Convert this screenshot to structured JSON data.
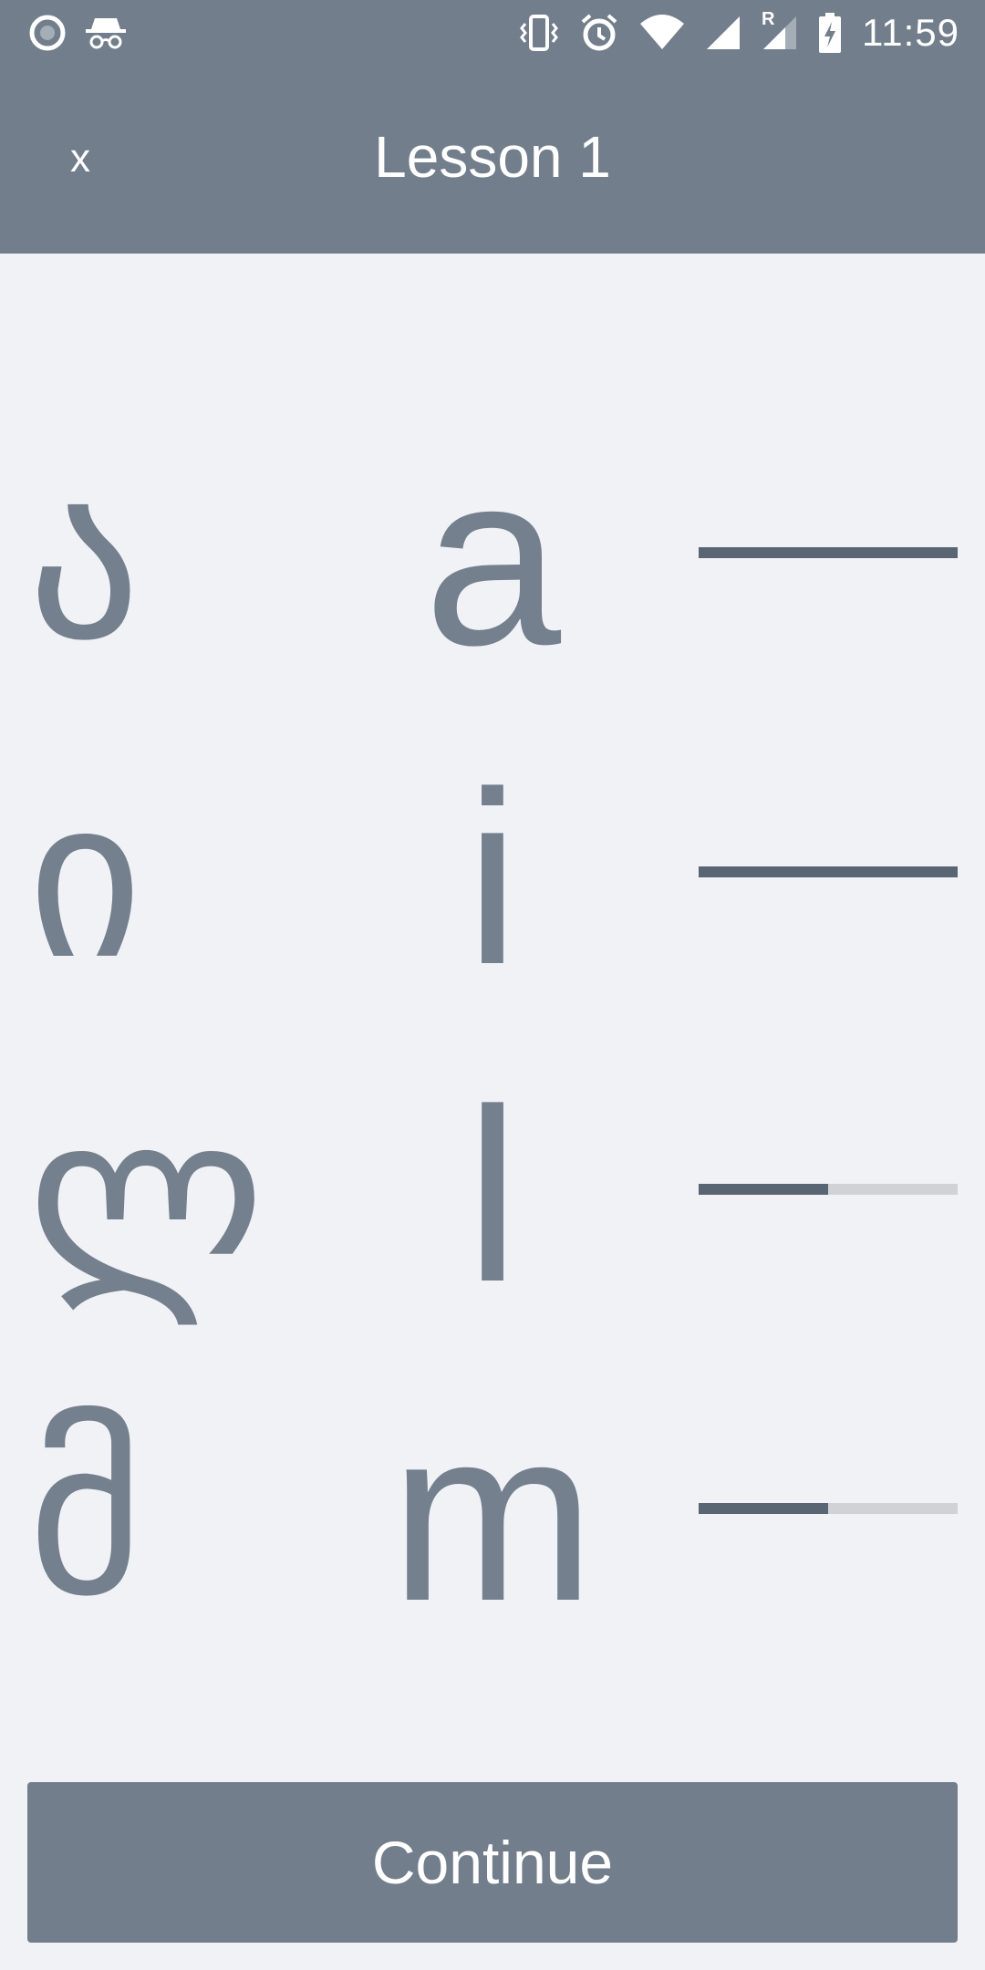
{
  "status_bar": {
    "time": "11:59",
    "icons": [
      "record-icon",
      "incognito-icon",
      "vibrate-icon",
      "alarm-icon",
      "wifi-icon",
      "signal-icon",
      "roaming-signal-icon",
      "battery-charging-icon"
    ],
    "roaming_label": "R"
  },
  "app_bar": {
    "close_label": "x",
    "title": "Lesson 1"
  },
  "letters": [
    {
      "georgian": "ა",
      "latin": "a",
      "progress": 1.0
    },
    {
      "georgian": "ი",
      "latin": "i",
      "progress": 1.0
    },
    {
      "georgian": "ლ",
      "latin": "l",
      "progress": 0.5
    },
    {
      "georgian": "მ",
      "latin": "m",
      "progress": 0.5
    }
  ],
  "continue_label": "Continue",
  "colors": {
    "bar": "#737e8c",
    "background": "#f1f2f6",
    "glyph": "#74808e",
    "progress_fill": "#5a6573",
    "progress_track": "#d0d2d6"
  }
}
